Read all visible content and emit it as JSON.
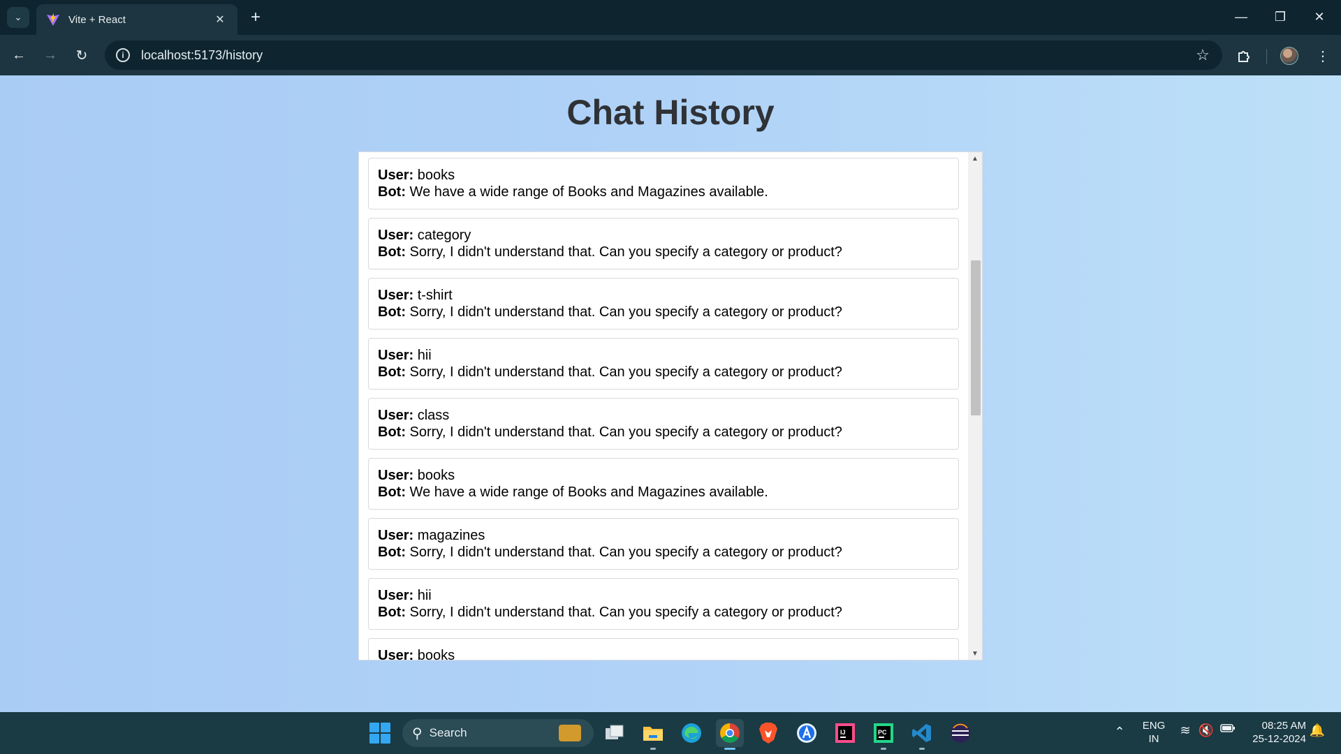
{
  "browser": {
    "tab_title": "Vite + React",
    "url": "localhost:5173/history"
  },
  "page": {
    "title": "Chat History",
    "user_label": "User:",
    "bot_label": "Bot:",
    "entries": [
      {
        "user": "books",
        "bot": "We have a wide range of Books and Magazines available."
      },
      {
        "user": "category",
        "bot": "Sorry, I didn't understand that. Can you specify a category or product?"
      },
      {
        "user": "t-shirt",
        "bot": "Sorry, I didn't understand that. Can you specify a category or product?"
      },
      {
        "user": "hii",
        "bot": "Sorry, I didn't understand that. Can you specify a category or product?"
      },
      {
        "user": "class",
        "bot": "Sorry, I didn't understand that. Can you specify a category or product?"
      },
      {
        "user": "books",
        "bot": "We have a wide range of Books and Magazines available."
      },
      {
        "user": "magazines",
        "bot": "Sorry, I didn't understand that. Can you specify a category or product?"
      },
      {
        "user": "hii",
        "bot": "Sorry, I didn't understand that. Can you specify a category or product?"
      },
      {
        "user": "books",
        "bot": ""
      }
    ]
  },
  "taskbar": {
    "search_label": "Search",
    "language_line1": "ENG",
    "language_line2": "IN",
    "time": "08:25 AM",
    "date": "25-12-2024",
    "apps": [
      "file-explorer",
      "edge",
      "chrome",
      "brave",
      "app-store",
      "intellij",
      "pycharm",
      "vscode",
      "eclipse"
    ]
  },
  "colors": {
    "page_bg_start": "#a9ccf5",
    "page_bg_end": "#bde0f8",
    "title_text": "#2f3236",
    "chrome_dark": "#0e2530",
    "chrome_mid": "#1c3540"
  }
}
